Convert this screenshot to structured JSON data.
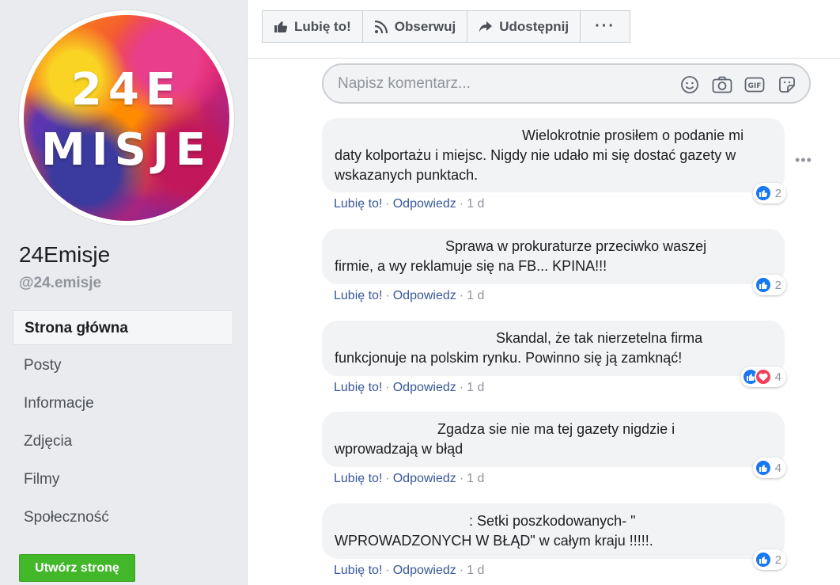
{
  "page": {
    "avatar_line1": "24E",
    "avatar_line2": "MISJE",
    "name": "24Emisje",
    "handle": "@24.emisje"
  },
  "nav": {
    "items": [
      "Strona główna",
      "Posty",
      "Informacje",
      "Zdjęcia",
      "Filmy",
      "Społeczność"
    ],
    "active_index": 0
  },
  "create_button": "Utwórz stronę",
  "actions": {
    "like": "Lubię to!",
    "follow": "Obserwuj",
    "share": "Udostępnij",
    "more": "···"
  },
  "comment_input": {
    "placeholder": "Napisz komentarz..."
  },
  "comment_links": {
    "like": "Lubię to!",
    "reply": "Odpowiedz",
    "time": "1 d"
  },
  "comments": [
    {
      "line1": "Wielokrotnie prosiłem o podanie mi",
      "rest": "daty kolportażu i miejsc. Nigdy nie udało mi się dostać gazety w wskazanych punktach.",
      "reactions": [
        "like"
      ],
      "count": "2"
    },
    {
      "line1": "Sprawa w prokuraturze przeciwko waszej",
      "rest": "firmie, a wy reklamuje się na FB... KPINA!!!",
      "reactions": [
        "like"
      ],
      "count": "2"
    },
    {
      "line1": "Skandal, że tak nierzetelna firma",
      "rest": "funkcjonuje na polskim rynku. Powinno się ją zamknąć!",
      "reactions": [
        "like",
        "love"
      ],
      "count": "4"
    },
    {
      "line1": "Zgadza sie nie ma tej gazety nigdzie i",
      "rest": "wprowadzają w błąd",
      "reactions": [
        "like"
      ],
      "count": "4"
    },
    {
      "line1": ": Setki poszkodowanych- \"",
      "rest": "WPROWADZONYCH W BŁĄD\" w całym kraju !!!!!.",
      "reactions": [
        "like"
      ],
      "count": "2"
    }
  ],
  "colors": {
    "link": "#385898",
    "like_blue": "#1877f2",
    "love_red": "#f33e58",
    "create_green": "#42b72a"
  }
}
